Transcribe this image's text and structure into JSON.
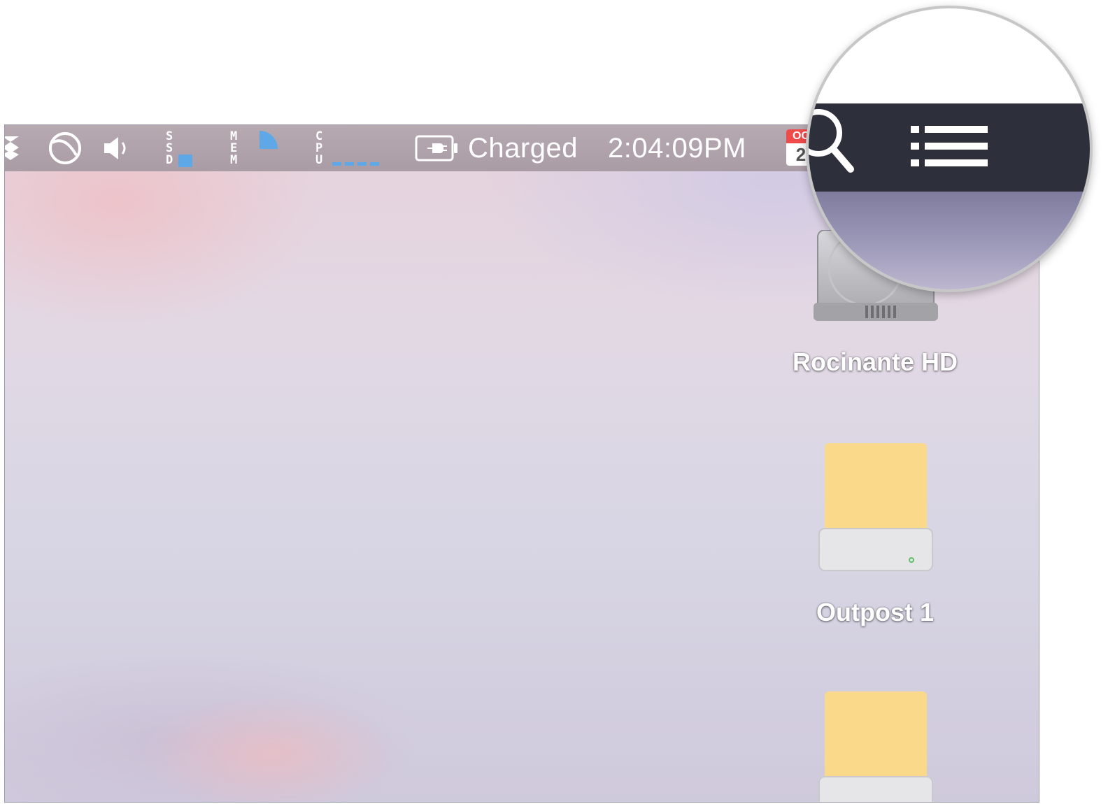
{
  "menubar": {
    "ssd_label": [
      "S",
      "S",
      "D"
    ],
    "mem_label": [
      "M",
      "E",
      "M"
    ],
    "cpu_label": [
      "C",
      "P",
      "U"
    ],
    "battery_status": "Charged",
    "clock": "2:04:09PM",
    "calendar_month": "OC",
    "calendar_day": "2"
  },
  "desktop": {
    "drives": [
      {
        "label": "Rocinante HD",
        "icon": "internal-hard-drive-icon"
      },
      {
        "label": "Outpost 1",
        "icon": "external-drive-icon"
      },
      {
        "label": "",
        "icon": "external-drive-icon"
      }
    ]
  },
  "magnifier": {
    "icons": [
      "spotlight-search-icon",
      "notification-center-list-icon"
    ]
  },
  "colors": {
    "menubar_dark": "#2d2f3a",
    "meter_blue": "#5fa8e8",
    "drive_yellow": "#fbd98a"
  }
}
